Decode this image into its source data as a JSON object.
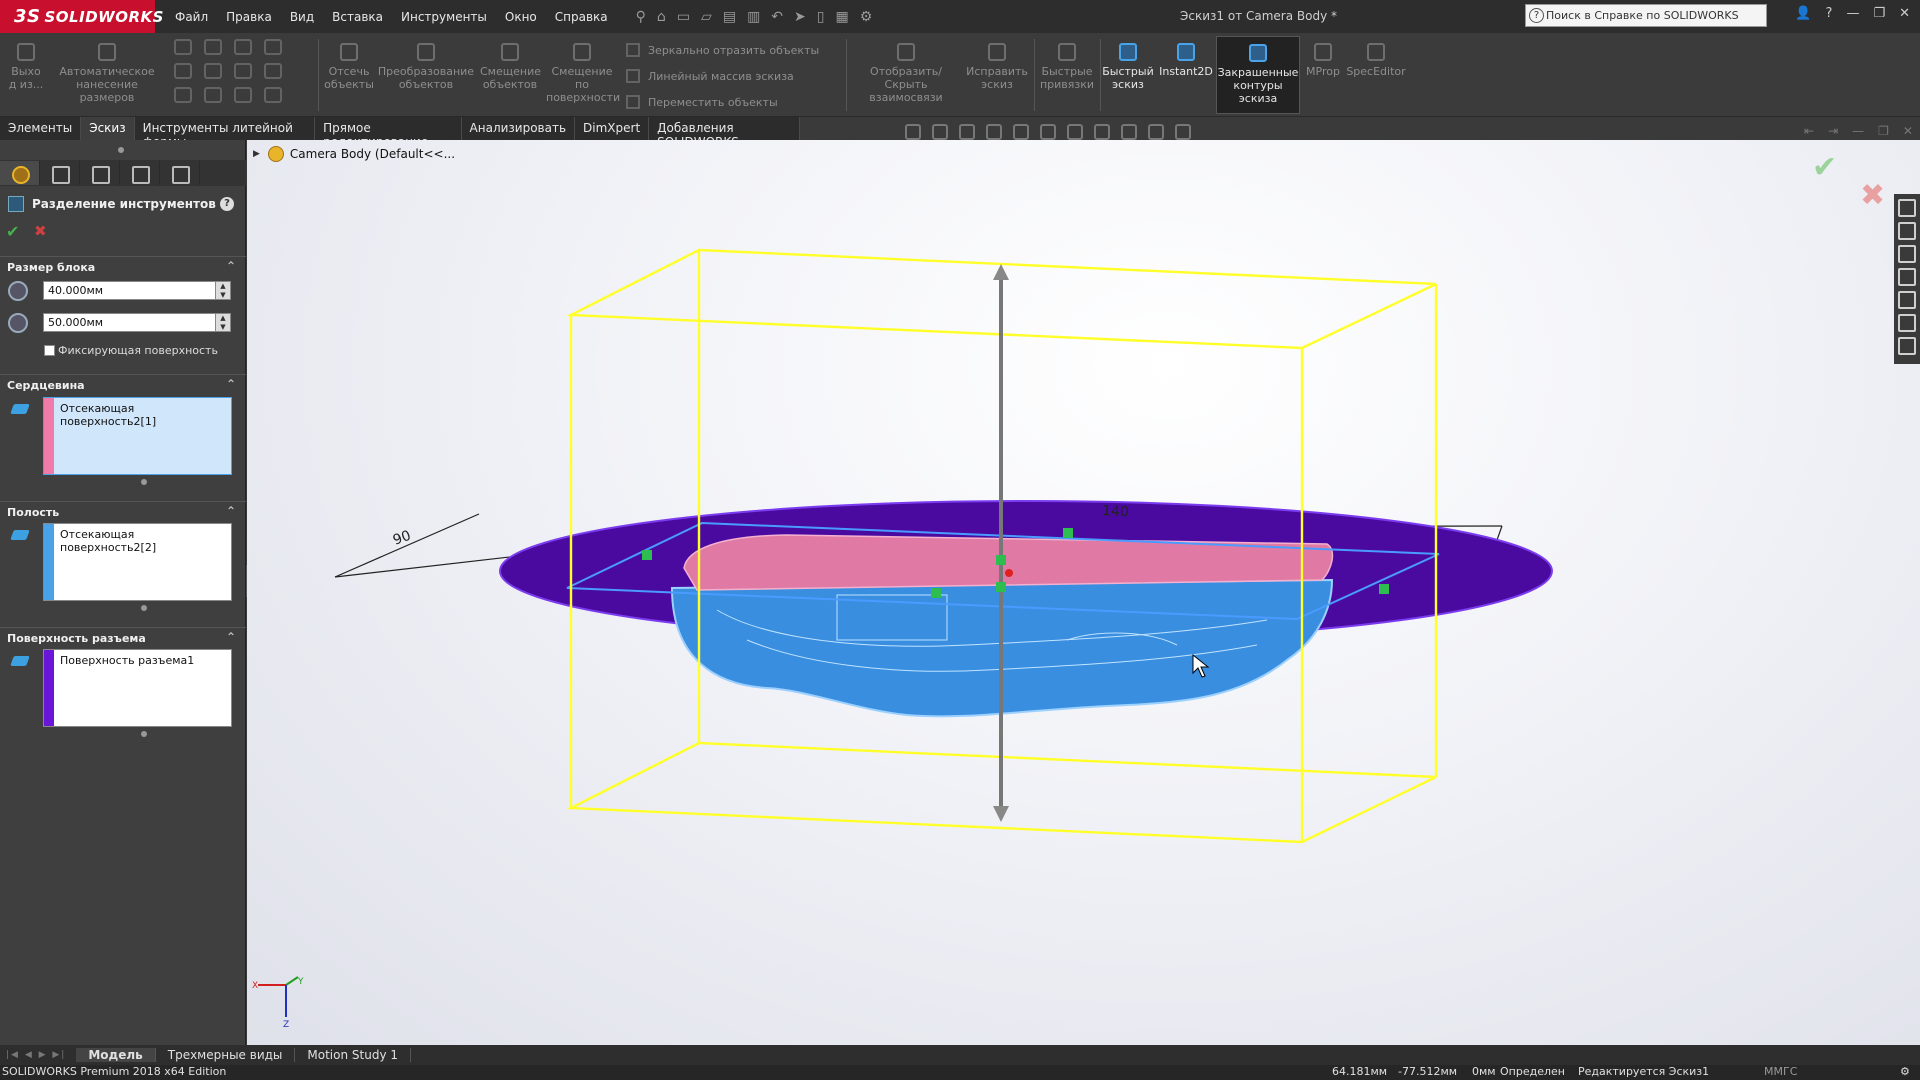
{
  "app": {
    "logo_mark": "3S",
    "logo_text": "SOLIDWORKS",
    "document_title": "Эскиз1 от Camera Body *",
    "search_placeholder": "Поиск в Справке по SOLIDWORKS",
    "search_icon_glyph": "?",
    "brand_color": "#c8102e"
  },
  "menu": [
    "Файл",
    "Правка",
    "Вид",
    "Вставка",
    "Инструменты",
    "Окно",
    "Справка"
  ],
  "commands": {
    "exit_sketch": "Выхо\nд из...",
    "smart_dim": "Автоматическое\nнанесение размеров",
    "trim": "Отсечь\nобъекты",
    "convert": "Преобразование\nобъектов",
    "offset": "Смещение\nобъектов",
    "offset_surface": "Смещение\nпо\nповерхности",
    "mirror": "Зеркально отразить объекты",
    "linear_pattern": "Линейный массив эскиза",
    "move": "Переместить объекты",
    "display_relations": "Отобразить/Скрыть\nвзаимосвязи",
    "repair": "Исправить\nэскиз",
    "quick_snaps": "Быстрые\nпривязки",
    "rapid_sketch": "Быстрый\nэскиз",
    "instant2d": "Instant2D",
    "shaded_contours": "Закрашенные\nконтуры\nэскиза",
    "mprop": "MProp",
    "speceditor": "SpecEditor"
  },
  "command_tabs": [
    "Элементы",
    "Эскиз",
    "Инструменты литейной формы",
    "Прямое редактирование",
    "Анализировать",
    "DimXpert",
    "Добавления SOLIDWORKS"
  ],
  "property_manager": {
    "title": "Разделение инструментов",
    "help": "?",
    "ok_glyph": "✔",
    "cancel_glyph": "✖",
    "block_size": {
      "header": "Размер блока",
      "depth1": "40.000мм",
      "depth2": "50.000мм",
      "interlock_label": "Фиксирующая поверхность"
    },
    "core": {
      "header": "Сердцевина",
      "item": "Отсекающая поверхность2[1]",
      "color": "#f07aa8"
    },
    "cavity": {
      "header": "Полость",
      "item": "Отсекающая поверхность2[2]",
      "color": "#4aa3e8"
    },
    "parting": {
      "header": "Поверхность разъема",
      "item": "Поверхность разъема1",
      "color": "#6a16d8"
    }
  },
  "feature_tree": {
    "root": "Camera Body  (Default<<..."
  },
  "viewport": {
    "dims": {
      "length": "140",
      "width": "90"
    },
    "box_color": "#ffff2a",
    "surface_color": "#4a0aa0",
    "core_color": "#e07aa4",
    "cavity_color": "#3a8ee0",
    "triad": {
      "x": "X",
      "y": "Y",
      "z": "Z"
    }
  },
  "bottom_tabs": [
    "Модель",
    "Трехмерные виды",
    "Motion Study 1"
  ],
  "status": {
    "edition": "SOLIDWORKS Premium 2018 x64 Edition",
    "x": "64.181мм",
    "y": "-77.512мм",
    "z": "0мм",
    "state": "Определен",
    "editing": "Редактируется Эскиз1",
    "units": "ММГС"
  }
}
